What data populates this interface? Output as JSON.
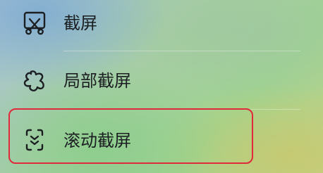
{
  "menu": {
    "items": [
      {
        "label": "截屏",
        "icon": "screenshot-scissors-icon"
      },
      {
        "label": "局部截屏",
        "icon": "partial-screenshot-blob-icon"
      },
      {
        "label": "滚动截屏",
        "icon": "scrolling-screenshot-icon"
      }
    ]
  },
  "colors": {
    "text": "#1c1f22",
    "icon_stroke": "#1c1f22",
    "highlight_border": "#e0293a"
  }
}
